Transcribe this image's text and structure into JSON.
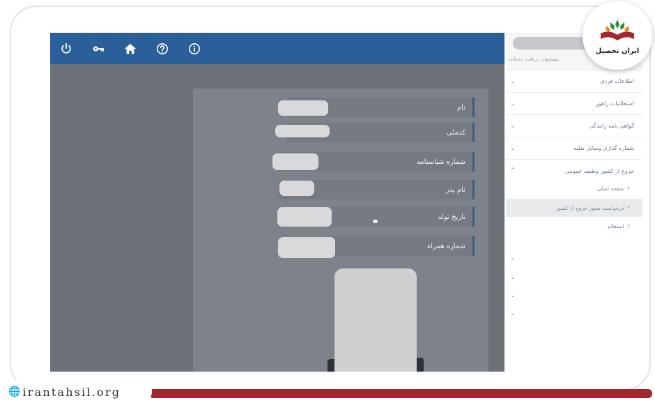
{
  "toolbar": {
    "icons": [
      "power-icon",
      "key-icon",
      "home-icon",
      "help-icon",
      "info-icon"
    ]
  },
  "form": {
    "fields": [
      {
        "label": "نام"
      },
      {
        "label": "کدملی"
      },
      {
        "label": "شماره شناسنامه"
      },
      {
        "label": "نام پدر"
      },
      {
        "label": "تاریخ تولد"
      },
      {
        "label": "شماره همراه"
      }
    ]
  },
  "sidebar": {
    "subtitle": "پیشخوان دریافت خدمات",
    "items": [
      {
        "label": "اطلاعات فردی",
        "chevron": "⌄"
      },
      {
        "label": "استعلامات راهور",
        "chevron": "⌄"
      },
      {
        "label": "گواهی نامه رانندگی",
        "chevron": "⌄"
      },
      {
        "label": "شماره گذاری وسایل نقلیه",
        "chevron": "⌄"
      },
      {
        "label": "خروج از کشور وظیفه عمومی",
        "chevron": "⌃"
      }
    ],
    "subitems": [
      {
        "label": "صفحه اصلی",
        "arrow": "›"
      },
      {
        "label": "درخواست مجوز خروج از کشور",
        "arrow": "›"
      },
      {
        "label": "استعلام",
        "arrow": "›"
      }
    ],
    "lone_chevrons": [
      "⌄",
      "⌄",
      "⌄",
      "⌄"
    ]
  },
  "logo": {
    "text": "ایران تحصیل"
  },
  "watermark": {
    "url": "irantahsil.org"
  },
  "colors": {
    "topbar": "#2a5f9a",
    "brand_red": "#a3262c",
    "brand_green": "#2e8b3a",
    "brand_orange": "#e68a1f"
  }
}
